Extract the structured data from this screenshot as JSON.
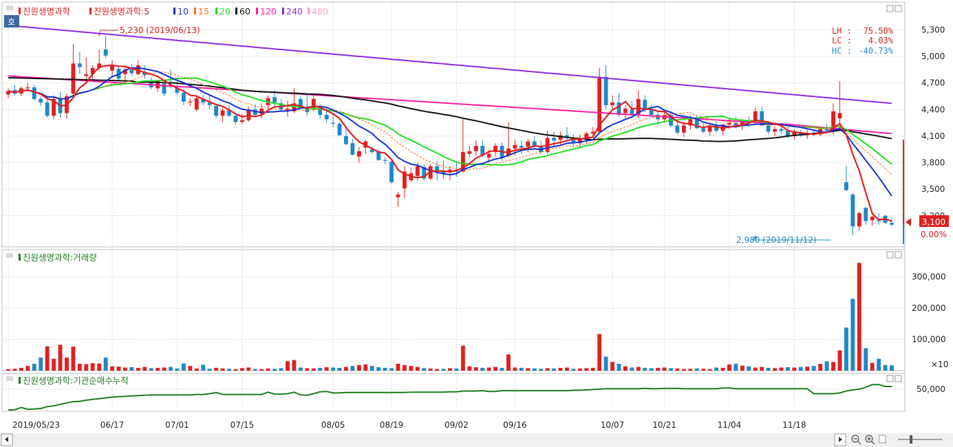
{
  "colors": {
    "up": "#e02020",
    "down": "#1e88c8",
    "ma5": "#e02020",
    "ma10": "#1530d0",
    "ma15": "#ff6a1a",
    "ma20": "#22dd22",
    "ma60": "#111111",
    "ma120": "#ff1aa0",
    "ma240": "#8a2be2",
    "ma480": "#ff9ac8",
    "volume_ma": "#2e7d32",
    "inst": "#1f7a1f"
  },
  "legend": {
    "price_title": "진원생명과학",
    "ma_title": "진원생명과학:5",
    "ma_items": [
      "10",
      "15",
      "20",
      "60",
      "120",
      "240",
      "480"
    ],
    "volume_title": "진원생명과학:거래량",
    "inst_title": "진원생명과학:기관순매수누적"
  },
  "badge": {
    "label": "호"
  },
  "stats": {
    "lh_label": "LH :",
    "lh_value": "75.50%",
    "lc_label": "LC :",
    "lc_value": "4.03%",
    "hc_label": "HC :",
    "hc_value": "-40.73%"
  },
  "price_marker": {
    "value": "3,100",
    "change": "0.00%"
  },
  "volume_unit": "×10",
  "icons": [
    "minimize-icon",
    "maximize-icon",
    "scroll-left-icon",
    "scroll-right-icon",
    "zoom-out-icon",
    "zoom-in-icon",
    "zoom-slider-icon"
  ],
  "chart_data": {
    "type": "candlestick",
    "title": "",
    "price_axis": {
      "ticks": [
        "5,300",
        "5,000",
        "4,700",
        "4,400",
        "4,100",
        "3,800",
        "3,500",
        "3,200"
      ],
      "ylim": [
        2880,
        5420
      ]
    },
    "volume_axis": {
      "ticks": [
        "300,000",
        "200,000",
        "100,000"
      ],
      "ylim": [
        0,
        350000
      ]
    },
    "inst_axis": {
      "ticks": [
        "50,000"
      ]
    },
    "x_tick_labels": [
      "2019/05/23",
      "06/17",
      "07/01",
      "07/15",
      "08/05",
      "08/19",
      "09/02",
      "09/16",
      "10/07",
      "10/21",
      "11/04",
      "11/18"
    ],
    "x_tick_index": [
      0,
      16,
      26,
      36,
      50,
      59,
      69,
      78,
      93,
      101,
      111,
      121
    ],
    "annotations": [
      {
        "text": "5,230 (2019/06/13)",
        "index": 14,
        "value": 5230
      },
      {
        "text": "2,980 (2019/11/12)",
        "index": 115,
        "value": 2980
      }
    ],
    "series_close": [
      {
        "name": "Close",
        "values": []
      }
    ],
    "candles": [
      [
        4570,
        4640,
        4530,
        4610
      ],
      [
        4620,
        4680,
        4560,
        4580
      ],
      [
        4580,
        4660,
        4550,
        4640
      ],
      [
        4640,
        4700,
        4600,
        4650
      ],
      [
        4650,
        4680,
        4500,
        4520
      ],
      [
        4520,
        4550,
        4440,
        4480
      ],
      [
        4480,
        4550,
        4310,
        4330
      ],
      [
        4330,
        4560,
        4290,
        4520
      ],
      [
        4520,
        4600,
        4310,
        4360
      ],
      [
        4360,
        4580,
        4300,
        4550
      ],
      [
        4580,
        5140,
        4560,
        4920
      ],
      [
        4920,
        5050,
        4800,
        4880
      ],
      [
        4780,
        4990,
        4700,
        4800
      ],
      [
        4800,
        4900,
        4720,
        4870
      ],
      [
        4870,
        5080,
        4840,
        4920
      ],
      [
        5080,
        5230,
        4980,
        5010
      ],
      [
        4840,
        4960,
        4780,
        4900
      ],
      [
        4860,
        4900,
        4720,
        4750
      ],
      [
        4800,
        4900,
        4720,
        4850
      ],
      [
        4850,
        4910,
        4780,
        4810
      ],
      [
        4800,
        4960,
        4790,
        4900
      ],
      [
        4820,
        4900,
        4750,
        4790
      ],
      [
        4710,
        4760,
        4630,
        4650
      ],
      [
        4640,
        4730,
        4600,
        4720
      ],
      [
        4690,
        4710,
        4550,
        4580
      ],
      [
        4680,
        4850,
        4640,
        4660
      ],
      [
        4640,
        4740,
        4560,
        4590
      ],
      [
        4590,
        4630,
        4450,
        4490
      ],
      [
        4480,
        4530,
        4440,
        4490
      ],
      [
        4400,
        4560,
        4380,
        4530
      ],
      [
        4520,
        4570,
        4450,
        4480
      ],
      [
        4480,
        4560,
        4410,
        4450
      ],
      [
        4440,
        4450,
        4300,
        4330
      ],
      [
        4330,
        4420,
        4260,
        4390
      ],
      [
        4390,
        4450,
        4320,
        4330
      ],
      [
        4330,
        4350,
        4230,
        4260
      ],
      [
        4260,
        4350,
        4240,
        4280
      ],
      [
        4280,
        4430,
        4260,
        4400
      ],
      [
        4400,
        4460,
        4320,
        4340
      ],
      [
        4350,
        4470,
        4300,
        4410
      ],
      [
        4450,
        4560,
        4360,
        4530
      ],
      [
        4540,
        4620,
        4430,
        4480
      ],
      [
        4470,
        4520,
        4380,
        4400
      ],
      [
        4390,
        4500,
        4320,
        4410
      ],
      [
        4380,
        4640,
        4360,
        4470
      ],
      [
        4520,
        4550,
        4410,
        4430
      ],
      [
        4430,
        4560,
        4330,
        4370
      ],
      [
        4400,
        4570,
        4380,
        4520
      ],
      [
        4420,
        4460,
        4300,
        4340
      ],
      [
        4340,
        4420,
        4250,
        4290
      ],
      [
        4250,
        4350,
        4200,
        4240
      ],
      [
        4240,
        4260,
        4100,
        4110
      ],
      [
        4100,
        4200,
        4000,
        4010
      ],
      [
        4020,
        4070,
        3880,
        3890
      ],
      [
        3870,
        3980,
        3800,
        3930
      ],
      [
        3970,
        4060,
        3900,
        4040
      ],
      [
        3950,
        3980,
        3900,
        3920
      ],
      [
        3920,
        3950,
        3820,
        3830
      ],
      [
        3830,
        3860,
        3780,
        3820
      ],
      [
        3810,
        3830,
        3560,
        3580
      ],
      [
        3410,
        3470,
        3300,
        3440
      ],
      [
        3510,
        3760,
        3400,
        3700
      ],
      [
        3600,
        3740,
        3580,
        3680
      ],
      [
        3650,
        3800,
        3600,
        3760
      ],
      [
        3750,
        3780,
        3600,
        3620
      ],
      [
        3620,
        3780,
        3600,
        3760
      ],
      [
        3760,
        3820,
        3600,
        3700
      ],
      [
        3700,
        3820,
        3620,
        3680
      ],
      [
        3690,
        3760,
        3600,
        3720
      ],
      [
        3720,
        3800,
        3640,
        3700
      ],
      [
        3700,
        4290,
        3690,
        3920
      ],
      [
        3900,
        3990,
        3860,
        3930
      ],
      [
        3930,
        4050,
        3880,
        3990
      ],
      [
        3990,
        4050,
        3860,
        3880
      ],
      [
        3860,
        3950,
        3800,
        3900
      ],
      [
        3920,
        4020,
        3870,
        3990
      ],
      [
        3990,
        4030,
        3820,
        3850
      ],
      [
        3880,
        4260,
        3860,
        3960
      ],
      [
        3960,
        4060,
        3880,
        4000
      ],
      [
        3990,
        4050,
        3900,
        3970
      ],
      [
        3980,
        4070,
        3920,
        4040
      ],
      [
        4040,
        4100,
        3950,
        3980
      ],
      [
        3980,
        4050,
        3900,
        3920
      ],
      [
        3920,
        4160,
        3900,
        4080
      ],
      [
        4080,
        4150,
        3990,
        4050
      ],
      [
        4060,
        4150,
        3990,
        4110
      ],
      [
        4110,
        4200,
        4040,
        4080
      ],
      [
        4070,
        4120,
        3990,
        4020
      ],
      [
        4020,
        4120,
        3960,
        4060
      ],
      [
        4060,
        4150,
        4020,
        4130
      ],
      [
        4130,
        4200,
        4080,
        4150
      ],
      [
        4150,
        4870,
        4120,
        4770
      ],
      [
        4770,
        4900,
        4400,
        4450
      ],
      [
        4450,
        4560,
        4400,
        4480
      ],
      [
        4480,
        4590,
        4320,
        4340
      ],
      [
        4360,
        4450,
        4300,
        4410
      ],
      [
        4400,
        4500,
        4330,
        4350
      ],
      [
        4350,
        4620,
        4300,
        4520
      ],
      [
        4510,
        4560,
        4370,
        4400
      ],
      [
        4400,
        4450,
        4320,
        4340
      ],
      [
        4340,
        4370,
        4250,
        4290
      ],
      [
        4290,
        4380,
        4250,
        4340
      ],
      [
        4340,
        4380,
        4200,
        4220
      ],
      [
        4220,
        4260,
        4120,
        4140
      ],
      [
        4140,
        4260,
        4090,
        4220
      ],
      [
        4220,
        4330,
        4170,
        4290
      ],
      [
        4290,
        4330,
        4180,
        4190
      ],
      [
        4190,
        4250,
        4130,
        4150
      ],
      [
        4150,
        4250,
        4100,
        4220
      ],
      [
        4220,
        4270,
        4140,
        4160
      ],
      [
        4160,
        4240,
        4110,
        4230
      ],
      [
        4230,
        4300,
        4180,
        4250
      ],
      [
        4250,
        4320,
        4190,
        4220
      ],
      [
        4220,
        4300,
        4170,
        4280
      ],
      [
        4280,
        4320,
        4200,
        4260
      ],
      [
        4260,
        4420,
        4240,
        4380
      ],
      [
        4380,
        4430,
        4210,
        4220
      ],
      [
        4220,
        4240,
        4120,
        4150
      ],
      [
        4150,
        4210,
        4100,
        4180
      ],
      [
        4180,
        4230,
        4130,
        4160
      ],
      [
        4160,
        4200,
        4080,
        4100
      ],
      [
        4100,
        4180,
        4060,
        4140
      ],
      [
        4140,
        4170,
        4090,
        4110
      ],
      [
        4110,
        4170,
        4070,
        4130
      ],
      [
        4130,
        4170,
        4100,
        4120
      ],
      [
        4120,
        4200,
        4100,
        4180
      ],
      [
        4180,
        4240,
        4130,
        4160
      ]
    ],
    "tail_candles": [
      [
        4160,
        4470,
        4110,
        4380
      ],
      [
        4300,
        4720,
        4180,
        4360
      ],
      [
        3580,
        3760,
        3480,
        3490
      ],
      [
        3440,
        3460,
        2980,
        3080
      ],
      [
        3080,
        3250,
        3030,
        3230
      ],
      [
        3290,
        3300,
        3100,
        3140
      ],
      [
        3150,
        3200,
        3090,
        3190
      ],
      [
        3150,
        3230,
        3100,
        3140
      ],
      [
        3200,
        3210,
        3110,
        3120
      ],
      [
        3120,
        3180,
        3080,
        3100
      ]
    ],
    "volume": [
      5000,
      6000,
      9000,
      15000,
      22000,
      42000,
      78000,
      38000,
      83000,
      42000,
      77000,
      22000,
      21000,
      24000,
      23000,
      42000,
      14000,
      13000,
      10000,
      11000,
      9000,
      12000,
      8000,
      9000,
      10000,
      12000,
      7000,
      23000,
      15000,
      7000,
      19000,
      6000,
      9000,
      7000,
      6000,
      5000,
      8000,
      10000,
      5000,
      5000,
      7000,
      6000,
      8000,
      30000,
      34000,
      10000,
      8000,
      7000,
      9000,
      11000,
      10000,
      9000,
      12000,
      15000,
      18000,
      20000,
      15000,
      11000,
      9000,
      8000,
      22000,
      18000,
      15000,
      12000,
      8000,
      7000,
      5000,
      6000,
      8000,
      7000,
      80000,
      14000,
      11000,
      9000,
      10000,
      12000,
      9000,
      52000,
      10000,
      9000,
      8000,
      7000,
      6000,
      8000,
      7000,
      9000,
      10000,
      6000,
      7000,
      8000,
      9000,
      117000,
      45000,
      28000,
      22000,
      14000,
      10000,
      12000,
      9000,
      8000,
      9000,
      10000,
      8000,
      7000,
      5000,
      6000,
      7000,
      6000,
      5000,
      10000,
      9000,
      20000,
      22000,
      16000,
      14000,
      10000,
      12000,
      9000,
      8000,
      10000,
      11000,
      10000,
      12000,
      13000,
      15000,
      22000
    ],
    "volume_tail": [
      30000,
      28000,
      65000,
      138000,
      230000,
      345000,
      72000,
      25000,
      38000,
      18000,
      17000
    ],
    "volume_up_index": [
      1,
      3,
      6,
      8,
      11,
      14,
      17,
      18,
      21,
      24,
      29,
      32,
      35,
      39,
      43,
      46,
      49,
      52,
      60,
      66,
      70,
      74,
      77,
      83,
      86,
      90,
      95,
      100,
      103,
      107,
      111,
      116,
      119
    ],
    "inst_cumulative": [
      -5000,
      -4000,
      2000,
      -3000,
      -2000,
      -1000,
      4000,
      6000,
      10000,
      14000,
      17000,
      18000,
      21000,
      23000,
      25000,
      27000,
      29000,
      30000,
      31000,
      32000,
      33000,
      34000,
      35000,
      35000,
      35000,
      35000,
      35000,
      35000,
      35000,
      36000,
      36000,
      38000,
      41000,
      36000,
      36000,
      36000,
      36000,
      36000,
      36000,
      36000,
      42000,
      37000,
      37000,
      38000,
      42000,
      35000,
      34000,
      38000,
      43000,
      44000,
      40000,
      40000,
      41000,
      41000,
      41000,
      41000,
      41000,
      41000,
      41000,
      41000,
      41000,
      41000,
      42000,
      42000,
      42000,
      42000,
      42000,
      42000,
      43000,
      43000,
      45000,
      45000,
      45000,
      46000,
      44000,
      44000,
      46000,
      46000,
      46000,
      46000,
      46000,
      46000,
      46000,
      46000,
      46000,
      46000,
      46000,
      47000,
      47000,
      48000,
      49000,
      50000,
      51000,
      51000,
      51000,
      51000,
      51000,
      51000,
      52000,
      51000,
      51000,
      52000,
      52000,
      52000,
      51000,
      51000,
      51000,
      51000,
      51000,
      51000,
      53000,
      53000,
      51000,
      51000,
      51000,
      51000,
      51000,
      51000,
      51000,
      51000,
      51000,
      51000,
      51000,
      51000,
      38000,
      38000,
      38000,
      38000,
      40000,
      45000,
      48000,
      50000,
      55000,
      62000,
      62000,
      57000,
      57000,
      57000,
      57000
    ]
  }
}
